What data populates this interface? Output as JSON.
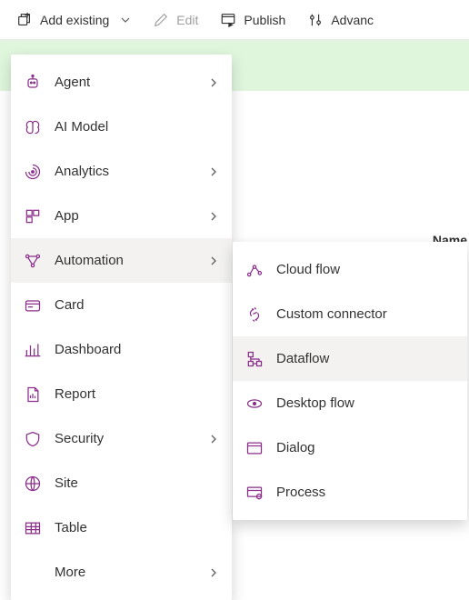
{
  "toolbar": {
    "add_existing": "Add existing",
    "edit": "Edit",
    "publish": "Publish",
    "advanced": "Advanc"
  },
  "background": {
    "name_header": "Name"
  },
  "menu": {
    "items": [
      {
        "label": "Agent",
        "has_submenu": true
      },
      {
        "label": "AI Model",
        "has_submenu": false
      },
      {
        "label": "Analytics",
        "has_submenu": true
      },
      {
        "label": "App",
        "has_submenu": true
      },
      {
        "label": "Automation",
        "has_submenu": true,
        "hovered": true
      },
      {
        "label": "Card",
        "has_submenu": false
      },
      {
        "label": "Dashboard",
        "has_submenu": false
      },
      {
        "label": "Report",
        "has_submenu": false
      },
      {
        "label": "Security",
        "has_submenu": true
      },
      {
        "label": "Site",
        "has_submenu": false
      },
      {
        "label": "Table",
        "has_submenu": false
      },
      {
        "label": "More",
        "has_submenu": true,
        "more": true
      }
    ]
  },
  "submenu": {
    "items": [
      {
        "label": "Cloud flow"
      },
      {
        "label": "Custom connector"
      },
      {
        "label": "Dataflow",
        "hovered": true
      },
      {
        "label": "Desktop flow"
      },
      {
        "label": "Dialog"
      },
      {
        "label": "Process"
      }
    ]
  },
  "colors": {
    "accent": "#742774",
    "icon": "#8a2e8a"
  }
}
